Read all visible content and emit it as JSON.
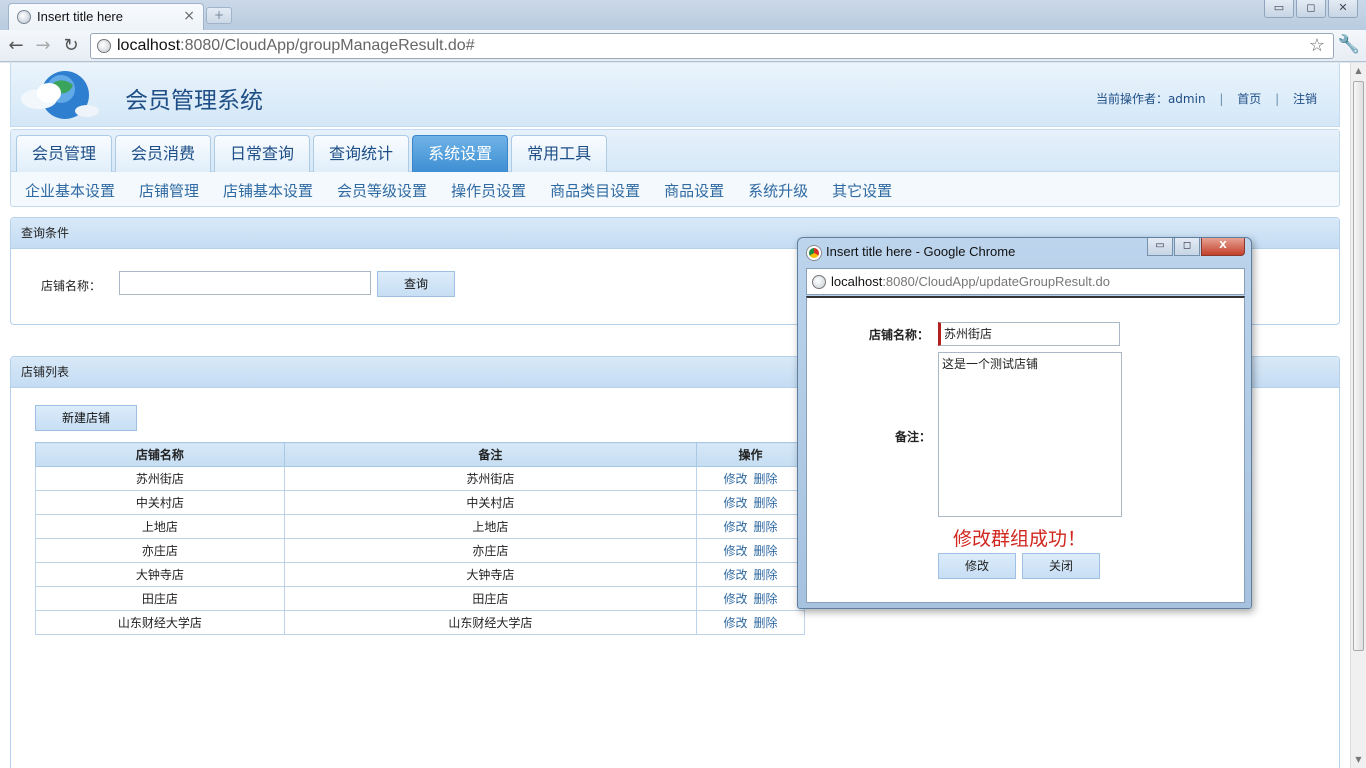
{
  "browser": {
    "tab_title": "Insert title here",
    "tab_close": "×",
    "new_tab": "+",
    "url_host": "localhost",
    "url_rest": ":8080/CloudApp/groupManageResult.do#",
    "window_buttons": [
      "▭",
      "◻",
      "✕"
    ]
  },
  "header": {
    "system_name": "会员管理系统",
    "operator_label": "当前操作者：",
    "operator": "admin",
    "home_link": "首页",
    "logout_link": "注销"
  },
  "top_menu": {
    "tabs": [
      "会员管理",
      "会员消费",
      "日常查询",
      "查询统计",
      "系统设置",
      "常用工具"
    ],
    "active": "系统设置"
  },
  "sub_menu": [
    "企业基本设置",
    "店铺管理",
    "店铺基本设置",
    "会员等级设置",
    "操作员设置",
    "商品类目设置",
    "商品设置",
    "系统升级",
    "其它设置"
  ],
  "query_panel": {
    "title": "查询条件",
    "field_label": "店铺名称：",
    "field_value": "",
    "search_button": "查询"
  },
  "list_panel": {
    "title": "店铺列表",
    "new_button": "新建店铺",
    "columns": [
      "店铺名称",
      "备注",
      "操作"
    ],
    "rows": [
      {
        "name": "苏州街店",
        "note": "苏州街店"
      },
      {
        "name": "中关村店",
        "note": "中关村店"
      },
      {
        "name": "上地店",
        "note": "上地店"
      },
      {
        "name": "亦庄店",
        "note": "亦庄店"
      },
      {
        "name": "大钟寺店",
        "note": "大钟寺店"
      },
      {
        "name": "田庄店",
        "note": "田庄店"
      },
      {
        "name": "山东财经大学店",
        "note": "山东财经大学店"
      }
    ],
    "edit_label": "修改",
    "delete_label": "删除"
  },
  "popup": {
    "window_title": "Insert title here - Google Chrome",
    "url_host": "localhost",
    "url_rest": ":8080/CloudApp/updateGroupResult.do",
    "name_label": "店铺名称：",
    "name_value": "苏州街店",
    "note_label": "备注：",
    "note_value": "这是一个测试店铺",
    "success_message": "修改群组成功！",
    "edit_button": "修改",
    "close_button": "关闭",
    "window_buttons": [
      "▭",
      "◻",
      "X"
    ]
  },
  "colors": {
    "accent": "#3e8fd3",
    "link": "#2f6aa2",
    "success_text": "#d0271f"
  }
}
